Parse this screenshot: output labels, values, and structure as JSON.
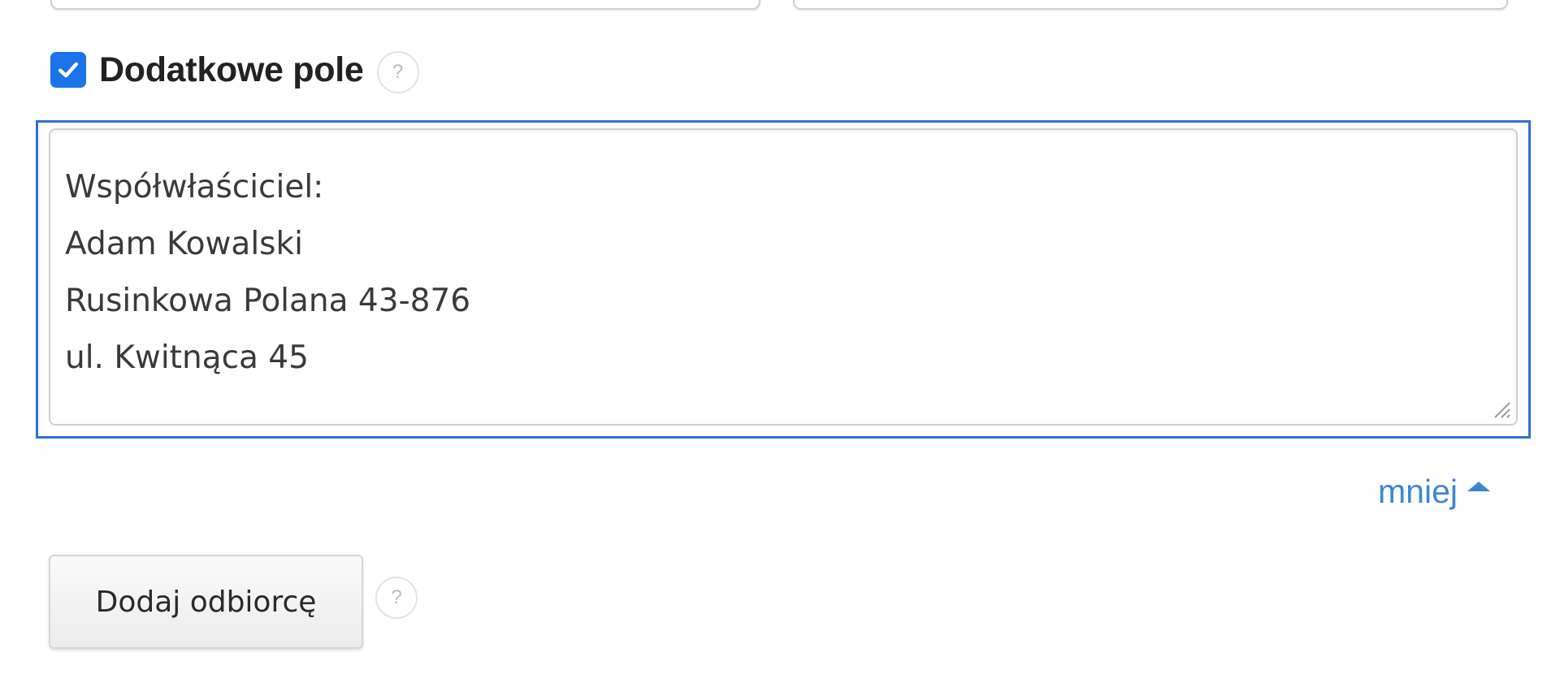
{
  "extra_field": {
    "checked": true,
    "label": "Dodatkowe pole",
    "help_glyph": "?"
  },
  "textarea": {
    "lines": [
      "Współwłaściciel:",
      "Adam Kowalski",
      "Rusinkowa Polana 43-876",
      "ul. Kwitnąca 45"
    ]
  },
  "less_link": {
    "label": "mniej",
    "icon": "caret-up-icon"
  },
  "add_recipient": {
    "label": "Dodaj odbiorcę",
    "help_glyph": "?"
  },
  "colors": {
    "accent": "#1a73e8",
    "focus_border": "#2f6fd6",
    "link": "#3d86d6"
  }
}
